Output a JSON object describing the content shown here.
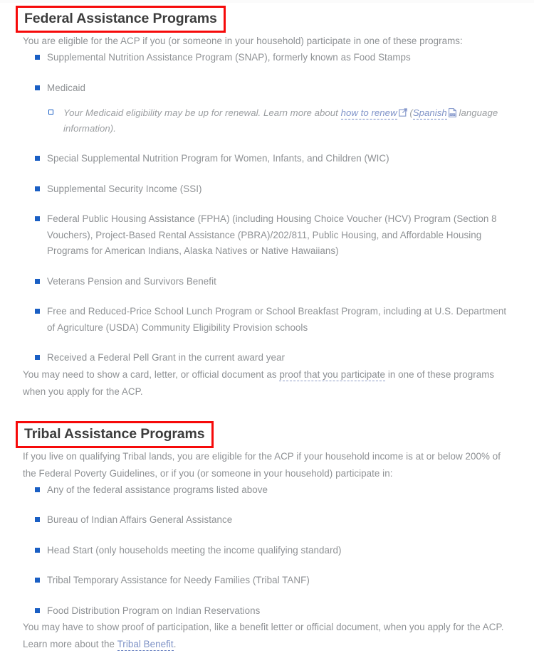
{
  "sections": [
    {
      "heading": "Federal Assistance Programs",
      "intro": "You are eligible for the ACP if you (or someone in your household) participate in one of these programs:",
      "items": [
        {
          "text": "Supplemental Nutrition Assistance Program (SNAP), formerly known as Food Stamps"
        },
        {
          "text": "Medicaid",
          "sub": {
            "lead": "Your Medicaid eligibility may be up for renewal. Learn more about ",
            "link1": "how to renew",
            "mid": " (",
            "link2": "Spanish",
            "tail": " language information)."
          }
        },
        {
          "text": "Special Supplemental Nutrition Program for Women, Infants, and Children (WIC)"
        },
        {
          "text": "Supplemental Security Income (SSI)"
        },
        {
          "text": "Federal Public Housing Assistance (FPHA) (including Housing Choice Voucher (HCV) Program (Section 8 Vouchers), Project-Based Rental Assistance (PBRA)/202/811, Public Housing, and Affordable Housing Programs for American Indians, Alaska Natives or Native Hawaiians)"
        },
        {
          "text": "Veterans Pension and Survivors Benefit"
        },
        {
          "text": "Free and Reduced-Price School Lunch Program or School Breakfast Program, including at U.S. Department of Agriculture (USDA) Community Eligibility Provision schools"
        },
        {
          "text": "Received a Federal Pell Grant in the current award year"
        }
      ],
      "outro": {
        "lead": "You may need to show a card, letter, or official document as ",
        "link": "proof that you participate",
        "tail": " in one of these programs when you apply for the ACP."
      }
    },
    {
      "heading": "Tribal Assistance Programs",
      "intro": "If you live on qualifying Tribal lands, you are eligible for the ACP if your household income is at or below 200% of the Federal Poverty Guidelines, or if you (or someone in your household) participate in:",
      "items": [
        {
          "text": "Any of the federal assistance programs listed above"
        },
        {
          "text": "Bureau of Indian Affairs General Assistance"
        },
        {
          "text": "Head Start (only households meeting the income qualifying standard)"
        },
        {
          "text": "Tribal Temporary Assistance for Needy Families (Tribal TANF)"
        },
        {
          "text": "Food Distribution Program on Indian Reservations"
        }
      ],
      "outro": {
        "lead": "You may have to show proof of participation, like a benefit letter or official document, when you apply for the ACP.  Learn more about the ",
        "link": "Tribal Benefit",
        "tail": "."
      }
    }
  ],
  "icons": {
    "external_link": "external-link-icon",
    "pdf": "pdf-file-icon",
    "bullet": "square-bullet-icon",
    "sub_bullet": "hollow-square-bullet-icon"
  },
  "colors": {
    "annotation_box": "#f60a0a",
    "bullet_blue": "#1a5fc4",
    "body_text": "#8e9194",
    "heading_text": "#3d3d3d",
    "link": "#7f93c9"
  }
}
